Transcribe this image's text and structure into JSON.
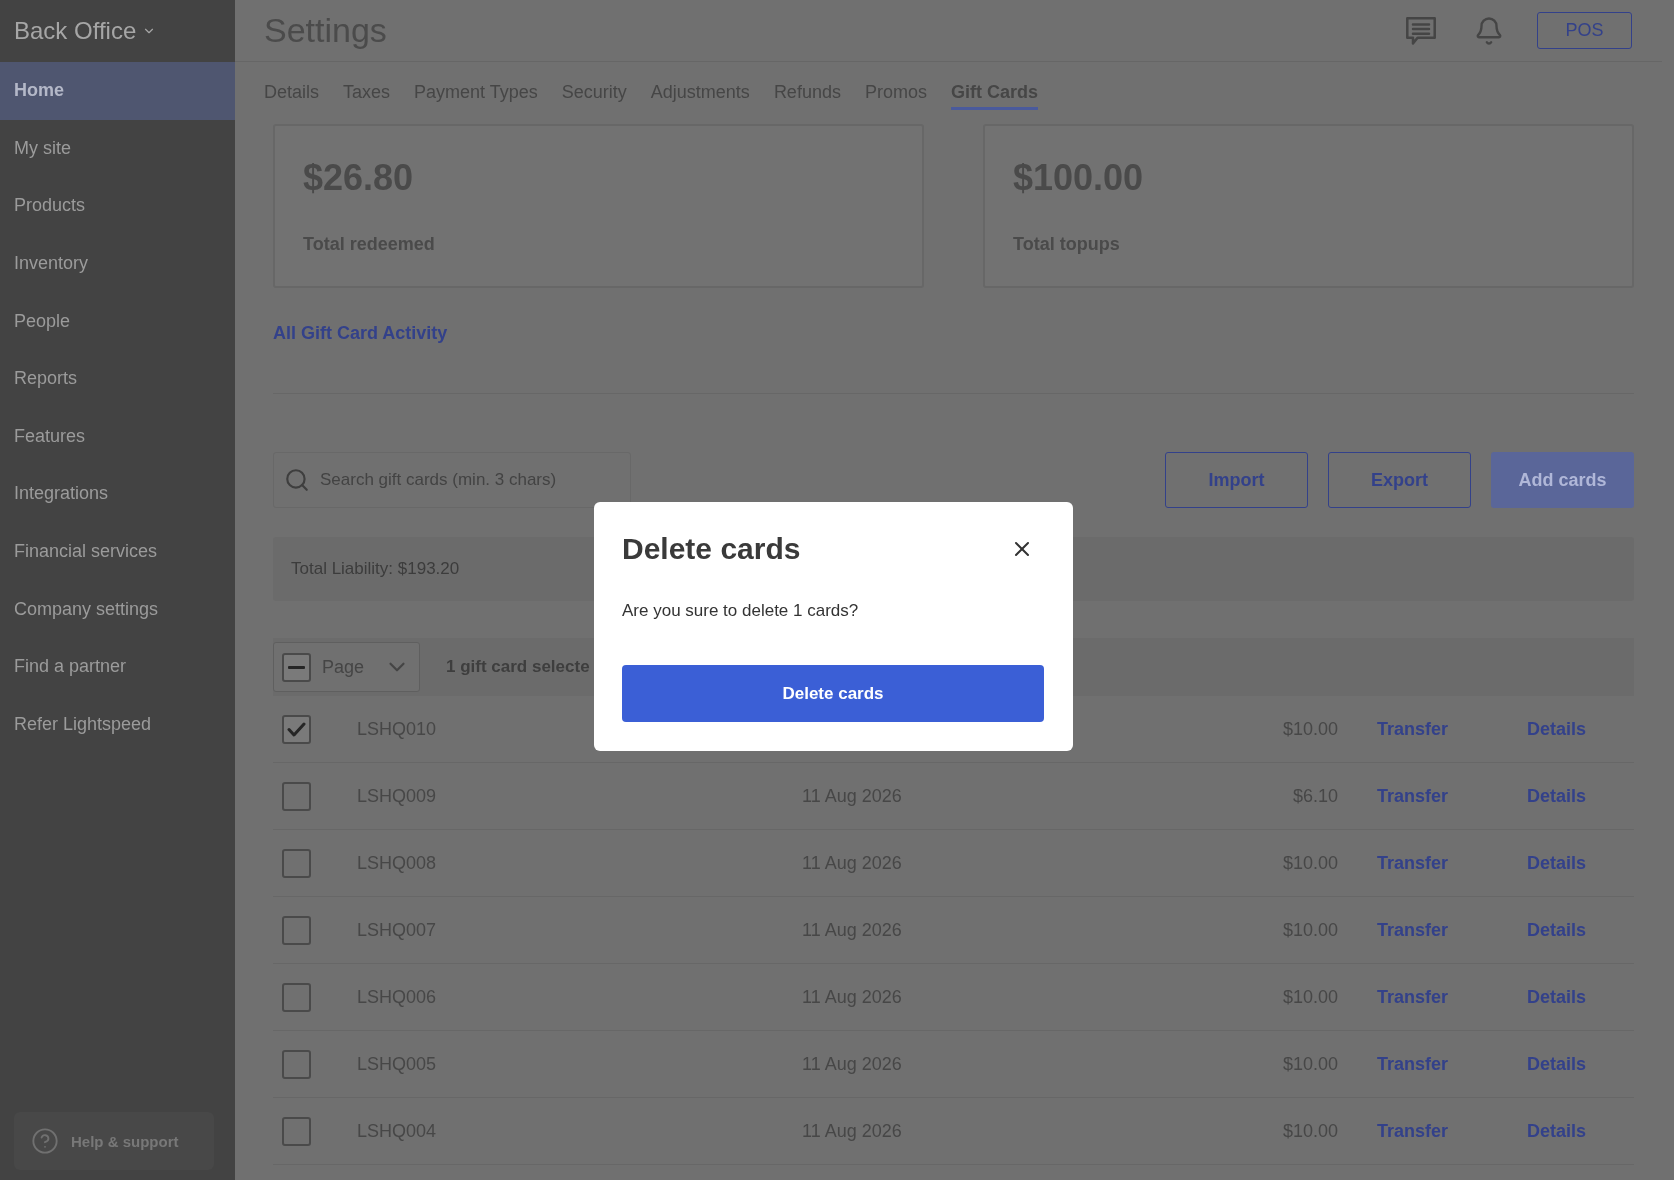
{
  "sidebar": {
    "title": "Back Office",
    "items": [
      {
        "label": "Home",
        "selected": true
      },
      {
        "label": "My site",
        "selected": false
      },
      {
        "label": "Products",
        "selected": false
      },
      {
        "label": "Inventory",
        "selected": false
      },
      {
        "label": "People",
        "selected": false
      },
      {
        "label": "Reports",
        "selected": false
      },
      {
        "label": "Features",
        "selected": false
      },
      {
        "label": "Integrations",
        "selected": false
      },
      {
        "label": "Financial services",
        "selected": false
      },
      {
        "label": "Company settings",
        "selected": false
      },
      {
        "label": "Find a partner",
        "selected": false
      },
      {
        "label": "Refer Lightspeed",
        "selected": false
      }
    ],
    "help": "Help & support"
  },
  "header": {
    "title": "Settings",
    "pos_button": "POS"
  },
  "tabs": [
    {
      "label": "Details",
      "selected": false
    },
    {
      "label": "Taxes",
      "selected": false
    },
    {
      "label": "Payment Types",
      "selected": false
    },
    {
      "label": "Security",
      "selected": false
    },
    {
      "label": "Adjustments",
      "selected": false
    },
    {
      "label": "Refunds",
      "selected": false
    },
    {
      "label": "Promos",
      "selected": false
    },
    {
      "label": "Gift Cards",
      "selected": true
    }
  ],
  "summary_cards": [
    {
      "amount": "$26.80",
      "label": "Total redeemed"
    },
    {
      "amount": "$100.00",
      "label": "Total topups"
    }
  ],
  "activity_link": "All Gift Card Activity",
  "search": {
    "placeholder": "Search gift cards (min. 3 chars)"
  },
  "actions": [
    {
      "label": "Import",
      "kind": "outline"
    },
    {
      "label": "Export",
      "kind": "outline"
    },
    {
      "label": "Add cards",
      "kind": "primary"
    }
  ],
  "total_liability": "Total Liability: $193.20",
  "table": {
    "select_all": {
      "label": "Page",
      "indeterminate": true
    },
    "selection_text": "1 gift card selecte",
    "rows": [
      {
        "checked": true,
        "code": "LSHQ010",
        "amount": "$10.00",
        "transfer": "Transfer",
        "details": "Details"
      },
      {
        "checked": false,
        "code": "LSHQ009",
        "date": "11 Aug 2026",
        "amount": "$6.10",
        "transfer": "Transfer",
        "details": "Details"
      },
      {
        "checked": false,
        "code": "LSHQ008",
        "date": "11 Aug 2026",
        "amount": "$10.00",
        "transfer": "Transfer",
        "details": "Details"
      },
      {
        "checked": false,
        "code": "LSHQ007",
        "date": "11 Aug 2026",
        "amount": "$10.00",
        "transfer": "Transfer",
        "details": "Details"
      },
      {
        "checked": false,
        "code": "LSHQ006",
        "date": "11 Aug 2026",
        "amount": "$10.00",
        "transfer": "Transfer",
        "details": "Details"
      },
      {
        "checked": false,
        "code": "LSHQ005",
        "date": "11 Aug 2026",
        "amount": "$10.00",
        "transfer": "Transfer",
        "details": "Details"
      },
      {
        "checked": false,
        "code": "LSHQ004",
        "date": "11 Aug 2026",
        "amount": "$10.00",
        "transfer": "Transfer",
        "details": "Details"
      }
    ]
  },
  "dialog": {
    "title": "Delete cards",
    "message": "Are you sure to delete 1 cards?",
    "confirm": "Delete cards"
  }
}
